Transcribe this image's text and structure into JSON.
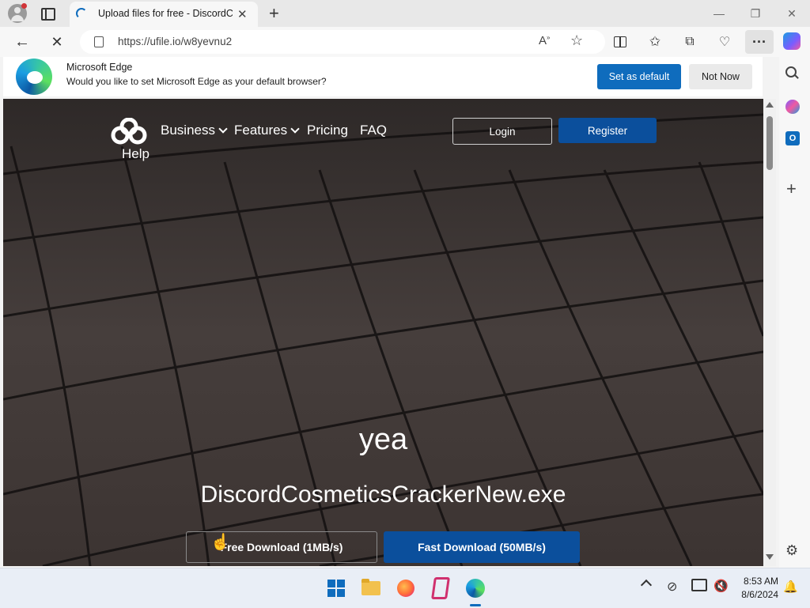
{
  "browser": {
    "tab": {
      "title": "Upload files for free - DiscordCo"
    },
    "address": {
      "url": "https://ufile.io/w8yevnu2"
    },
    "window_controls": [
      "minimize",
      "restore",
      "close"
    ]
  },
  "infobar": {
    "title": "Microsoft Edge",
    "message": "Would you like to set Microsoft Edge as your default browser?",
    "set_default_label": "Set as default",
    "not_now_label": "Not Now"
  },
  "site": {
    "nav": {
      "help": "Help",
      "business": "Business",
      "features": "Features",
      "pricing": "Pricing",
      "faq": "FAQ",
      "login": "Login",
      "register": "Register"
    },
    "hero": {
      "title": "yea",
      "filename": "DiscordCosmeticsCrackerNew.exe",
      "free_download": "Free Download (1MB/s)",
      "fast_download": "Fast Download (50MB/s)"
    }
  },
  "taskbar": {
    "time": "8:53 AM",
    "date": "8/6/2024"
  },
  "colors": {
    "edge_blue": "#0f6cbd",
    "site_register": "#0b4f9c",
    "hero_bg": "#3a3432"
  }
}
